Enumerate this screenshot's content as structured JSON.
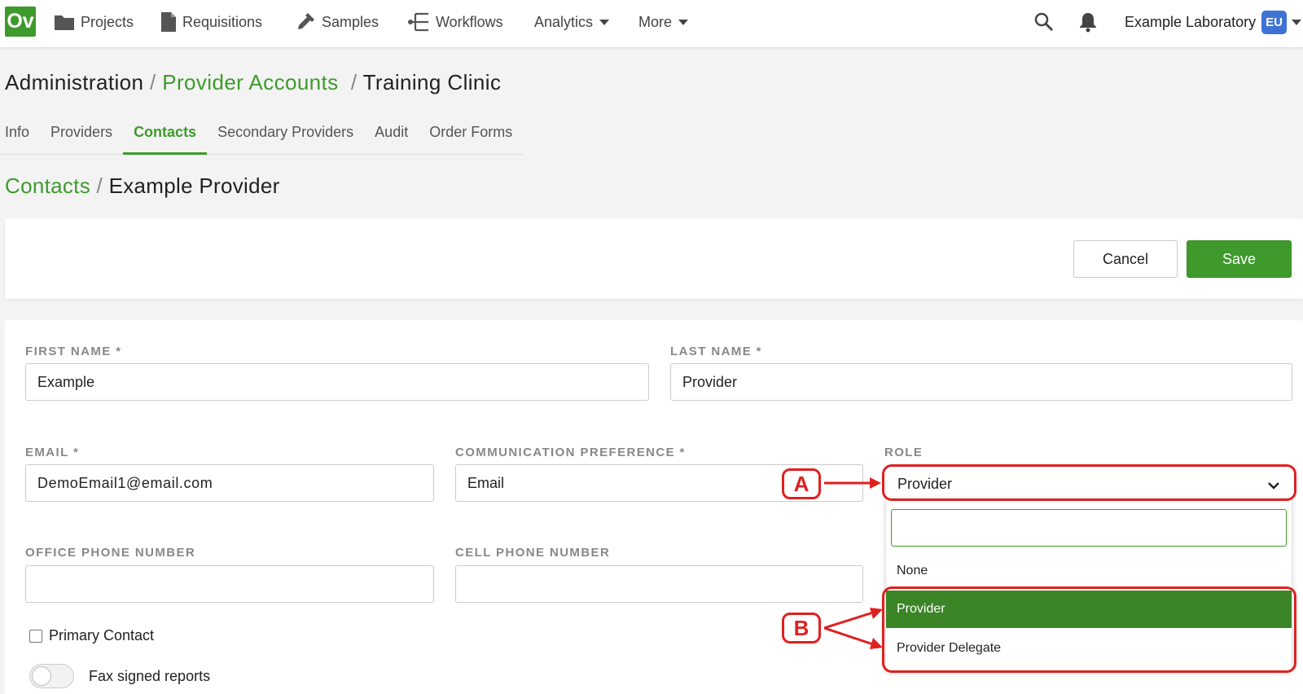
{
  "nav": {
    "logo": "Ov",
    "items": [
      {
        "label": "Projects",
        "icon": "folder-icon"
      },
      {
        "label": "Requisitions",
        "icon": "document-icon"
      },
      {
        "label": "Samples",
        "icon": "pipette-icon"
      },
      {
        "label": "Workflows",
        "icon": "workflow-icon"
      },
      {
        "label": "Analytics",
        "icon": "caret-down-icon"
      },
      {
        "label": "More",
        "icon": "caret-down-icon"
      }
    ],
    "lab_name": "Example Laboratory",
    "lab_badge": "EU"
  },
  "breadcrumb": {
    "root": "Administration",
    "section": "Provider Accounts",
    "current": "Training Clinic"
  },
  "tabs": [
    "Info",
    "Providers",
    "Contacts",
    "Secondary Providers",
    "Audit",
    "Order Forms"
  ],
  "active_tab": "Contacts",
  "subcrumb": {
    "parent": "Contacts",
    "current": "Example Provider"
  },
  "actions": {
    "cancel": "Cancel",
    "save": "Save"
  },
  "form": {
    "first_name_label": "FIRST NAME *",
    "first_name": "Example",
    "last_name_label": "LAST NAME *",
    "last_name": "Provider",
    "email_label": "EMAIL *",
    "email": "DemoEmail1@email.com",
    "comm_label": "COMMUNICATION PREFERENCE *",
    "comm_value": "Email",
    "role_label": "ROLE",
    "role_value": "Provider",
    "office_label": "OFFICE PHONE NUMBER",
    "office_value": "",
    "cell_label": "CELL PHONE NUMBER",
    "cell_value": "",
    "primary_contact": "Primary Contact",
    "fax_signed": "Fax signed reports"
  },
  "role_options": [
    "None",
    "Provider",
    "Provider Delegate"
  ],
  "role_selected": "Provider",
  "annotations": {
    "a": "A",
    "b": "B",
    "color": "#e02020"
  },
  "colors": {
    "brand_green": "#3f9a2c",
    "selected_option": "#3b8526",
    "badge_blue": "#3e73d6"
  }
}
